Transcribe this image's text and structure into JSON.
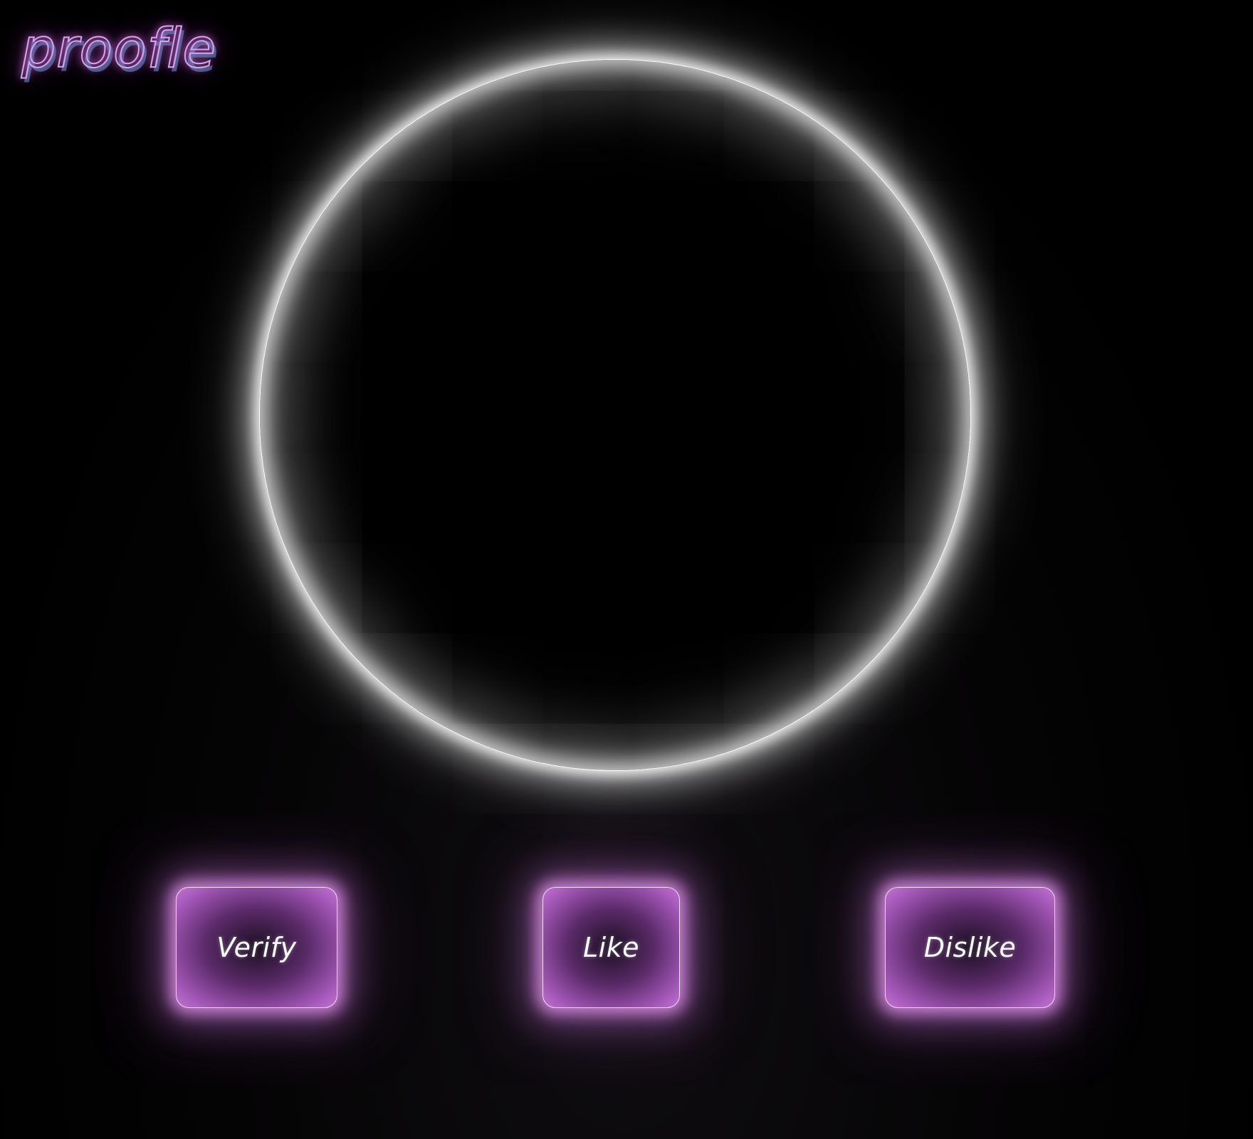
{
  "app": {
    "logo_text": "proofle"
  },
  "actions": [
    {
      "label": "Verify"
    },
    {
      "label": "Like"
    },
    {
      "label": "Dislike"
    }
  ],
  "colors": {
    "background": "#000000",
    "ring_glow": "#ffffff",
    "button_accent": "#c373d4",
    "logo_stroke": "#d9a3ee",
    "logo_shadow": "#6e96d2"
  }
}
